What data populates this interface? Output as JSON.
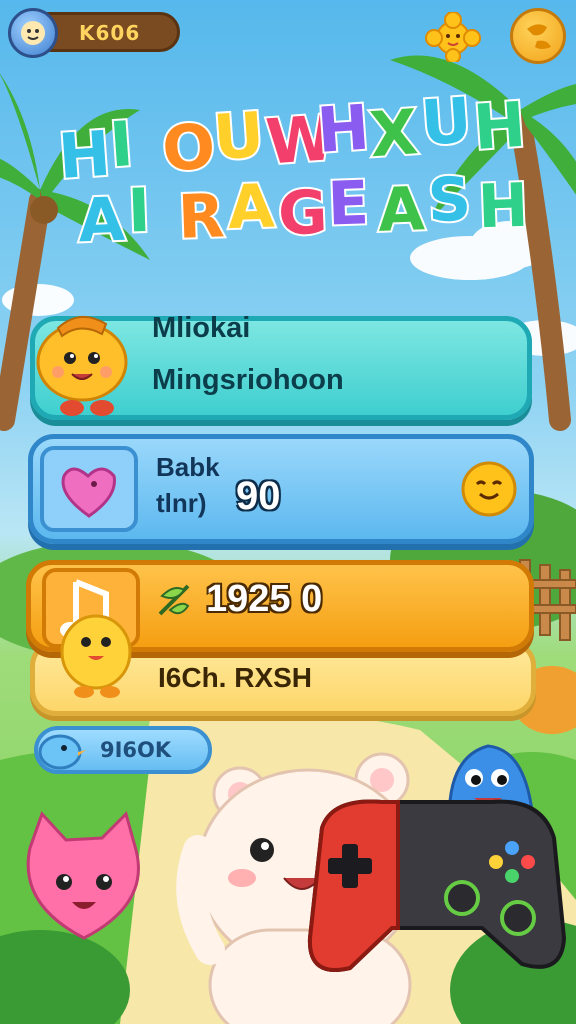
{
  "top_bar": {
    "currency_value": "K606"
  },
  "title": {
    "line1": "HIOUWHXUH",
    "line2": "AIRAGEASH",
    "letters1": [
      "H",
      "I",
      "O",
      "U",
      "W",
      "H",
      "X",
      "U",
      "H"
    ],
    "letters2": [
      "A",
      "I",
      "R",
      "A",
      "G",
      "E",
      "A",
      "S",
      "H"
    ],
    "letter_colors": [
      "#35c0e8",
      "#2fd18a",
      "#ff8a1f",
      "#ffcf2a",
      "#f23f6c",
      "#8a5cf0",
      "#3fc24a"
    ]
  },
  "panels": {
    "profile": {
      "line1": "Mliokai",
      "line2": "Mingsriohoon"
    },
    "stats": {
      "line1": "Babk",
      "line2": "tlnr)",
      "score": "90"
    },
    "coins": {
      "value": "1925 0"
    },
    "rank": {
      "label": "I6Ch. RXSH"
    }
  },
  "back_button": {
    "label": "9I6OK"
  },
  "colors": {
    "sky": "#56b8ec",
    "grass": "#7ccd57",
    "panel_teal": "#3fcfcf",
    "panel_blue": "#5cb8ef",
    "panel_orange": "#f59f12",
    "panel_yellow": "#fdd66a"
  },
  "icons": [
    "avatar-coin-icon",
    "sun-icon",
    "globe-icon",
    "fox-mascot-icon",
    "heart-icon",
    "smiley-coin-icon",
    "music-note-icon",
    "leaf-icon",
    "bird-icon",
    "gamepad-icon"
  ]
}
